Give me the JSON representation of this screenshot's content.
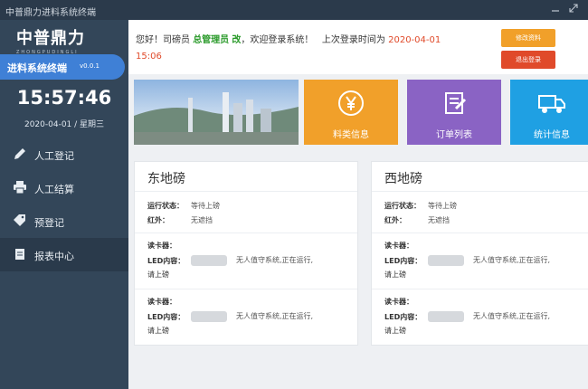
{
  "window": {
    "title": "中普鼎力进料系统终端",
    "minimize_icon": "minimize-icon",
    "maximize_icon": "expand-icon"
  },
  "sidebar": {
    "logo": {
      "main": "中普鼎力",
      "sub": "ZHONGPUDINGLI"
    },
    "app_name": "进料系统终端",
    "version": "v0.0.1",
    "clock": "15:57:46",
    "date": "2020-04-01 / 星期三",
    "items": [
      {
        "label": "人工登记",
        "icon": "pencil-icon"
      },
      {
        "label": "人工结算",
        "icon": "printer-icon"
      },
      {
        "label": "预登记",
        "icon": "tag-icon"
      },
      {
        "label": "报表中心",
        "icon": "report-icon"
      }
    ]
  },
  "header": {
    "greeting": "您好！司磅员",
    "role": "总管理员",
    "name": "改",
    "welcome": "，欢迎登录系统！",
    "last_login_label": "上次登录时间为",
    "last_login_date": "2020-04-01",
    "last_login_time": "15:06",
    "edit_button": "修改资料",
    "logout_button": "退出登录"
  },
  "cards": [
    {
      "label": "料类信息",
      "icon": "yen-icon",
      "color": "#f1a02a"
    },
    {
      "label": "订单列表",
      "icon": "order-list-icon",
      "color": "#8a63c4"
    },
    {
      "label": "统计信息",
      "icon": "truck-icon",
      "color": "#1fa0e3"
    }
  ],
  "panels": [
    {
      "title": "东地磅",
      "status_label": "运行状态：",
      "status_value": "等待上磅",
      "infrared_label": "红外：",
      "infrared_value": "无遮挡",
      "readers": [
        {
          "card_label": "读卡器：",
          "led_label": "LED内容：",
          "led_text": "无人值守系统,正在运行,",
          "led_text2": "请上磅"
        },
        {
          "card_label": "读卡器：",
          "led_label": "LED内容：",
          "led_text": "无人值守系统,正在运行,",
          "led_text2": "请上磅"
        }
      ]
    },
    {
      "title": "西地磅",
      "status_label": "运行状态：",
      "status_value": "等待上磅",
      "infrared_label": "红外：",
      "infrared_value": "无遮挡",
      "readers": [
        {
          "card_label": "读卡器：",
          "led_label": "LED内容：",
          "led_text": "无人值守系统,正在运行,",
          "led_text2": "请上磅"
        },
        {
          "card_label": "读卡器：",
          "led_label": "LED内容：",
          "led_text": "无人值守系统,正在运行,",
          "led_text2": "请上磅"
        }
      ]
    }
  ]
}
